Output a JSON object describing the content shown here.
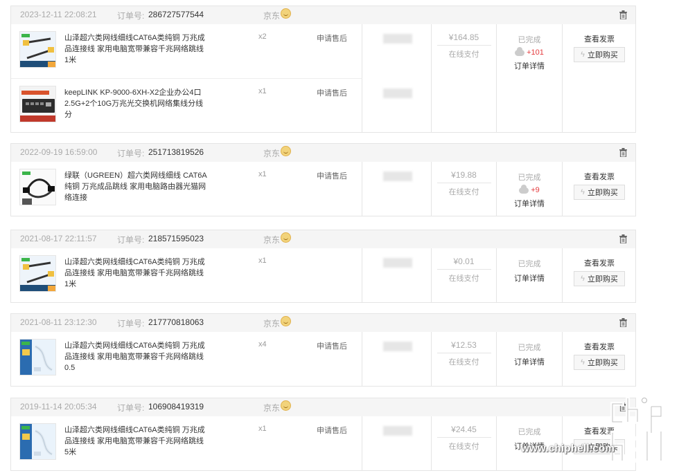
{
  "labels": {
    "order_no": "订单号:",
    "shop": "京东",
    "after_sale": "申请售后",
    "pay_type": "在线支付",
    "status_done": "已完成",
    "order_detail": "订单详情",
    "view_invoice": "查看发票",
    "buy_now": "立即购买"
  },
  "orders": [
    {
      "time": "2023-12-11 22:08:21",
      "number": "286727577544",
      "price": "¥164.85",
      "jd_bean": "+101",
      "items": [
        {
          "name": "山泽超六类网线细线CAT6A类纯铜 万兆成品连接线 家用电脑宽带兼容千兆网络跳线 1米",
          "qty": "x2",
          "after_sale": true,
          "thumb": "samzhe-blue"
        },
        {
          "name": "keepLINK KP-9000-6XH-X2企业办公4口2.5G+2个10G万兆光交换机网络集线分线分",
          "qty": "x1",
          "after_sale": true,
          "thumb": "switch-dark"
        }
      ]
    },
    {
      "time": "2022-09-19 16:59:00",
      "number": "251713819526",
      "price": "¥19.88",
      "jd_bean": "+9",
      "items": [
        {
          "name": "绿联（UGREEN）超六类网线细线 CAT6A纯铜 万兆成品跳线 家用电脑路由器光猫网络连接",
          "qty": "x1",
          "after_sale": true,
          "thumb": "ugreen-black"
        }
      ]
    },
    {
      "time": "2021-08-17 22:11:57",
      "number": "218571595023",
      "price": "¥0.01",
      "jd_bean": "",
      "items": [
        {
          "name": "山泽超六类网线细线CAT6A类纯铜 万兆成品连接线 家用电脑宽带兼容千兆网络跳线 1米",
          "qty": "x1",
          "after_sale": false,
          "thumb": "samzhe-blue"
        }
      ]
    },
    {
      "time": "2021-08-11 23:12:30",
      "number": "217770818063",
      "price": "¥12.53",
      "jd_bean": "",
      "items": [
        {
          "name": "山泽超六类网线细线CAT6A类纯铜 万兆成品连接线 家用电脑宽带兼容千兆网络跳线 0.5",
          "qty": "x4",
          "after_sale": true,
          "thumb": "samzhe-white"
        }
      ]
    },
    {
      "time": "2019-11-14 20:05:34",
      "number": "106908419319",
      "price": "¥24.45",
      "jd_bean": "",
      "items": [
        {
          "name": "山泽超六类网线细线CAT6A类纯铜 万兆成品连接线 家用电脑宽带兼容千兆网络跳线 5米",
          "qty": "x1",
          "after_sale": true,
          "thumb": "samzhe-white"
        }
      ]
    }
  ],
  "watermark": {
    "text": "www.chiphell.com",
    "logo": "chiphell-logo"
  },
  "colors": {
    "accent_red": "#e4393c",
    "header_bg": "#f5f5f5",
    "border": "#e5e5e5"
  }
}
